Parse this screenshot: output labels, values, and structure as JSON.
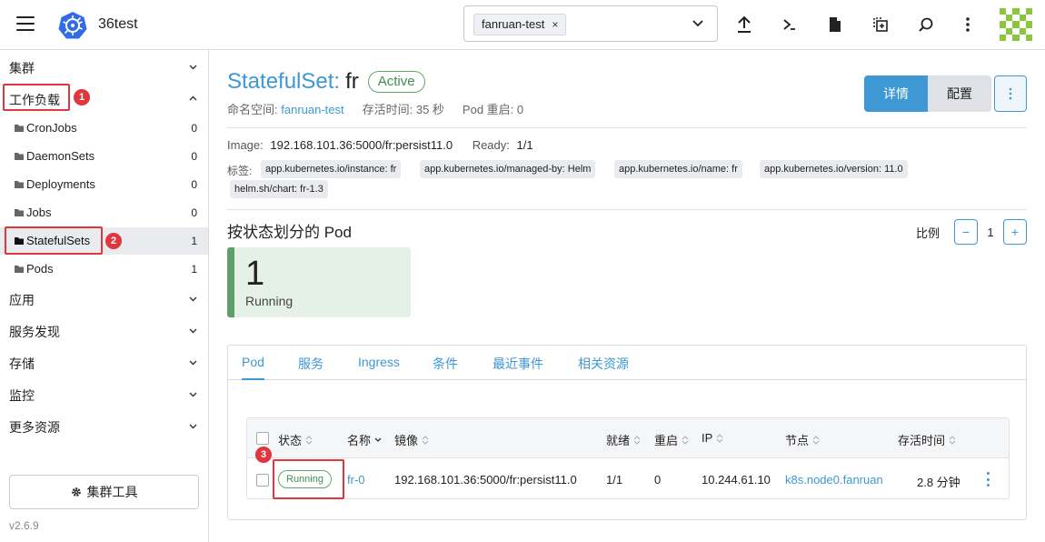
{
  "header": {
    "app_name": "36test",
    "namespace_chip": "fanruan-test",
    "chip_remove": "×"
  },
  "sidebar": {
    "groups": [
      {
        "label": "集群"
      },
      {
        "label": "工作负载"
      },
      {
        "label": "应用"
      },
      {
        "label": "服务发现"
      },
      {
        "label": "存储"
      },
      {
        "label": "监控"
      },
      {
        "label": "更多资源"
      }
    ],
    "items": [
      {
        "label": "CronJobs",
        "count": "0"
      },
      {
        "label": "DaemonSets",
        "count": "0"
      },
      {
        "label": "Deployments",
        "count": "0"
      },
      {
        "label": "Jobs",
        "count": "0"
      },
      {
        "label": "StatefulSets",
        "count": "1"
      },
      {
        "label": "Pods",
        "count": "1"
      }
    ],
    "cluster_tools": "集群工具",
    "version": "v2.6.9",
    "markers": [
      "1",
      "2",
      "3"
    ]
  },
  "main": {
    "title_kind": "StatefulSet:",
    "title_name": "fr",
    "status": "Active",
    "namespace_label": "命名空间:",
    "namespace_value": "fanruan-test",
    "age": "存活时间: 35 秒",
    "restarts": "Pod 重启: 0",
    "btn_detail": "详情",
    "btn_config": "配置",
    "image_label": "Image:",
    "image_value": "192.168.101.36:5000/fr:persist11.0",
    "ready_label": "Ready:",
    "ready_value": "1/1",
    "labels_title": "标签:",
    "labels": [
      "app.kubernetes.io/instance: fr",
      "app.kubernetes.io/managed-by: Helm",
      "app.kubernetes.io/name: fr",
      "app.kubernetes.io/version: 11.0",
      "helm.sh/chart: fr-1.3"
    ],
    "pods_by_state_title": "按状态划分的 Pod",
    "scale_label": "比例",
    "scale_minus": "−",
    "scale_value": "1",
    "scale_plus": "+",
    "card_count": "1",
    "card_state": "Running",
    "tabs": [
      {
        "label": "Pod"
      },
      {
        "label": "服务"
      },
      {
        "label": "Ingress"
      },
      {
        "label": "条件"
      },
      {
        "label": "最近事件"
      },
      {
        "label": "相关资源"
      }
    ],
    "table": {
      "headers": [
        "状态",
        "名称",
        "镜像",
        "就绪",
        "重启",
        "IP",
        "节点",
        "存活时间"
      ],
      "row": {
        "state": "Running",
        "name": "fr-0",
        "image": "192.168.101.36:5000/fr:persist11.0",
        "ready": "1/1",
        "restarts": "0",
        "ip": "10.244.61.10",
        "node": "k8s.node0.fanruan",
        "age": "2.8 分钟"
      }
    }
  },
  "colors": {
    "accent": "#3d98d3",
    "success": "#5da86f",
    "annotation_red": "#e0363d"
  }
}
